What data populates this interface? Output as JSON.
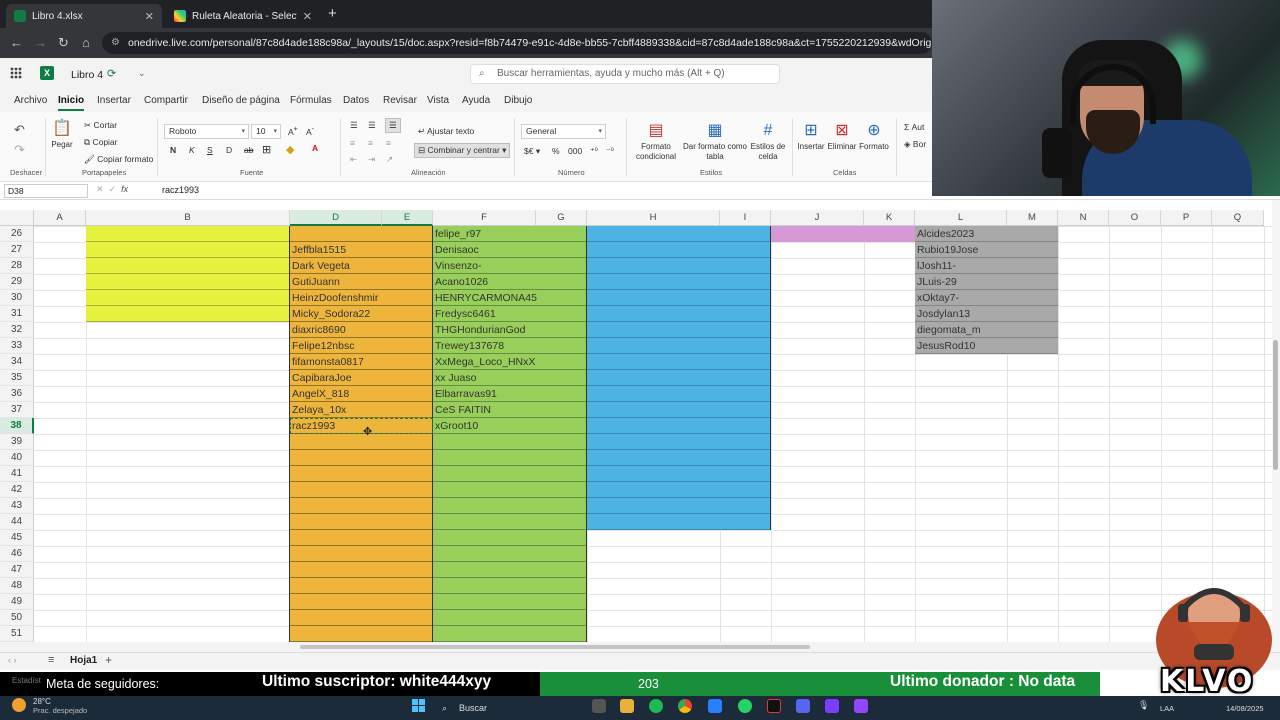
{
  "browser": {
    "tabs": [
      {
        "label": "Libro 4.xlsx",
        "active": true
      },
      {
        "label": "Ruleta Aleatoria - Selector Perso",
        "active": false
      }
    ],
    "url": "onedrive.live.com/personal/87c8d4ade188c98a/_layouts/15/doc.aspx?resid=f8b74479-e91c-4d8e-bb55-7cbff4889338&cid=87c8d4ade188c98a&ct=1755220212939&wdOrigin=OFFICECOM-WEB."
  },
  "app": {
    "filename": "Libro 4",
    "search_placeholder": "Buscar herramientas, ayuda y mucho más (Alt + Q)"
  },
  "ribbon_tabs": [
    "Archivo",
    "Inicio",
    "Insertar",
    "Compartir",
    "Diseño de página",
    "Fórmulas",
    "Datos",
    "Revisar",
    "Vista",
    "Ayuda",
    "Dibujo"
  ],
  "ribbon": {
    "undo_group": "Deshacer",
    "paste": "Pegar",
    "cut": "Cortar",
    "copy": "Copiar",
    "format_painter": "Copiar formato",
    "clipboard_group": "Portapapeles",
    "font_name": "Roboto",
    "font_size": "10",
    "font_group": "Fuente",
    "wrap_text": "Ajustar texto",
    "merge_center": "Combinar y centrar",
    "alignment_group": "Alineación",
    "number_format": "General",
    "number_group": "Número",
    "conditional_format": "Formato condicional",
    "format_as_table": "Dar formato como tabla",
    "cell_styles": "Estilos de celda",
    "styles_group": "Estilos",
    "insert": "Insertar",
    "delete": "Eliminar",
    "format": "Formato",
    "cells_group": "Celdas",
    "autosum": "Aut",
    "clear": "Bor"
  },
  "formula_bar": {
    "name_box": "D38",
    "formula": "racz1993"
  },
  "grid": {
    "columns": [
      "A",
      "B",
      "D",
      "E",
      "F",
      "G",
      "H",
      "I",
      "J",
      "K",
      "L",
      "M",
      "N",
      "O",
      "P",
      "Q"
    ],
    "rows": [
      "26",
      "27",
      "28",
      "29",
      "30",
      "31",
      "32",
      "33",
      "34",
      "35",
      "36",
      "37",
      "38",
      "39",
      "40",
      "41",
      "42",
      "43",
      "44",
      "45",
      "46",
      "47",
      "48",
      "49",
      "50",
      "51"
    ],
    "selected_row": "38",
    "col_d": [
      "",
      "Jeffbla1515",
      "Dark Vegeta",
      "GutiJuann",
      "HeinzDoofenshmir",
      "Micky_Sodora22",
      "diaxric8690",
      "Felipe12nbsc",
      "fifamonsta0817",
      "CapibaraJoe",
      "AngelX_818",
      "Zelaya_10x",
      "racz1993"
    ],
    "col_f": [
      "felipe_r97",
      "Denisaoc",
      "Vinsenzo-",
      "Acano1026",
      "HENRYCARMONA45",
      "Fredysc6461",
      "THGHondurianGod",
      "Trewey137678",
      "XxMega_Loco_HNxX",
      "xx Juaso",
      "Elbarravas91",
      "CeS FAITIN",
      "xGroot10"
    ],
    "col_l": [
      "Alcides2023",
      "Rubio19Jose",
      "lJosh11-",
      "JLuis-29",
      "xOktay7-",
      "Josdylan13",
      "diegomata_m",
      "JesusRod10"
    ],
    "colors": {
      "yellow": "#e6f03f",
      "orange": "#eeb53d",
      "green": "#98cf5b",
      "blue": "#4cb3e2",
      "pink": "#d59ad5",
      "gray": "#a9a9a9"
    }
  },
  "sheet_tab": "Hoja1",
  "overlay": {
    "stats_label": "Estadíst",
    "followers_goal": "Meta de seguidores:",
    "last_sub": "Ultimo suscriptor: white444xyy",
    "count": "203",
    "last_donor": "Ultimo donador : No data",
    "brand": "KLVO"
  },
  "taskbar": {
    "temperature": "28°C",
    "weather": "Prac. despejado",
    "search": "Buscar",
    "lang": "LAA",
    "date": "14/08/2025"
  }
}
